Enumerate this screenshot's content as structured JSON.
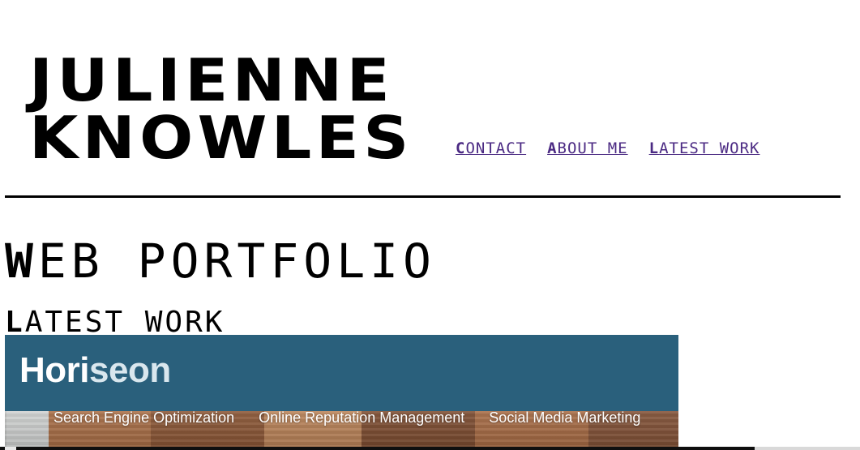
{
  "header": {
    "logo_line1": "JULIENNE",
    "logo_line2": "KNOWLES",
    "nav": [
      {
        "label": "CONTACT"
      },
      {
        "label": "ABOUT ME"
      },
      {
        "label": "LATEST WORK"
      }
    ],
    "nav_color": "#4b2a83"
  },
  "main": {
    "title": "WEB PORTFOLIO",
    "section_title": "LATEST WORK",
    "project": {
      "name": "Horiseon",
      "name_main": "Hori",
      "name_tail": "seon",
      "nav": [
        {
          "label": "Search Engine Optimization"
        },
        {
          "label": "Online Reputation Management"
        },
        {
          "label": "Social Media Marketing"
        }
      ],
      "header_color": "#2a607c"
    }
  }
}
